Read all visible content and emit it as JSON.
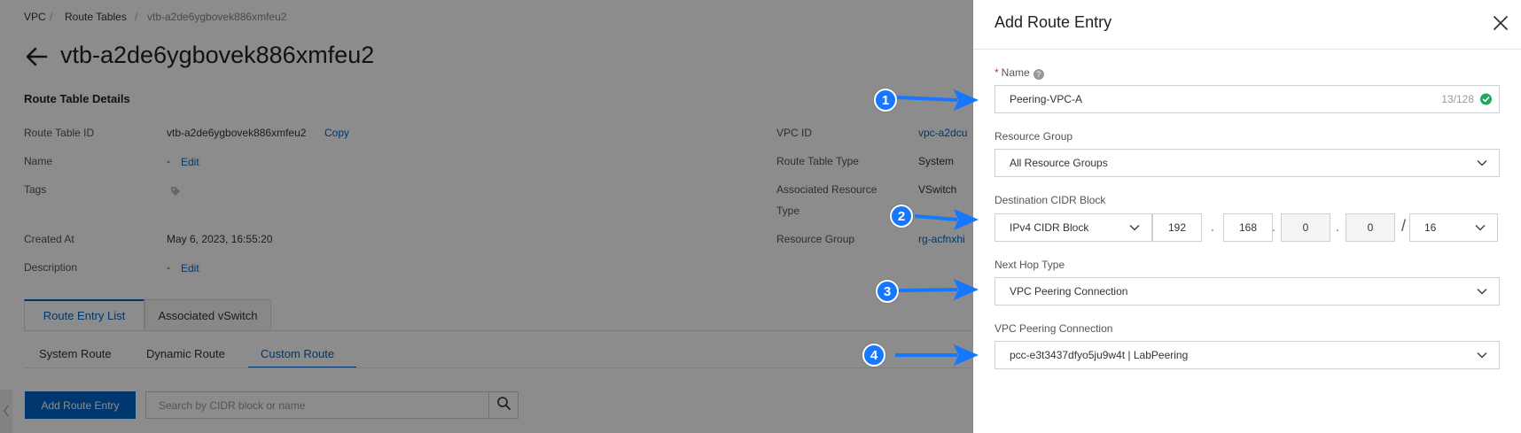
{
  "breadcrumb": [
    "VPC",
    "Route Tables",
    "vtb-a2de6ygbovek886xmfeu2"
  ],
  "page_title": "vtb-a2de6ygbovek886xmfeu2",
  "details": {
    "section_title": "Route Table Details",
    "route_table_id_label": "Route Table ID",
    "route_table_id_value": "vtb-a2de6ygbovek886xmfeu2",
    "copy_label": "Copy",
    "name_label": "Name",
    "name_value": "-",
    "edit_label": "Edit",
    "tags_label": "Tags",
    "created_at_label": "Created At",
    "created_at_value": "May 6, 2023, 16:55:20",
    "description_label": "Description",
    "description_value": "-",
    "vpc_id_label": "VPC ID",
    "vpc_id_value": "vpc-a2dcu",
    "route_table_type_label": "Route Table Type",
    "route_table_type_value": "System",
    "assoc_resource_label_1": "Associated Resource",
    "assoc_resource_label_2": "Type",
    "assoc_resource_value": "VSwitch",
    "resource_group_label": "Resource Group",
    "resource_group_value": "rg-acfnxhi"
  },
  "tabs": [
    "Route Entry List",
    "Associated vSwitch"
  ],
  "subtabs": [
    "System Route",
    "Dynamic Route",
    "Custom Route"
  ],
  "add_route_entry_button": "Add Route Entry",
  "search_placeholder": "Search by CIDR block or name",
  "drawer": {
    "title": "Add Route Entry",
    "name_label": "Name",
    "required_mark": "*",
    "help_mark": "?",
    "name_value": "Peering-VPC-A",
    "name_count": "13/128",
    "resource_group_label": "Resource Group",
    "resource_group_value": "All Resource Groups",
    "destination_label": "Destination CIDR Block",
    "cidr_type_value": "IPv4 CIDR Block",
    "octets": [
      "192",
      "168",
      "0",
      "0"
    ],
    "octet_sep": ".",
    "prefix_sep": "/",
    "prefix_value": "16",
    "next_hop_label": "Next Hop Type",
    "next_hop_value": "VPC Peering Connection",
    "peering_label": "VPC Peering Connection",
    "peering_value": "pcc-e3t3437dfyo5ju9w4t | LabPeering"
  },
  "callouts": [
    "1",
    "2",
    "3",
    "4"
  ],
  "colors": {
    "accent": "#0064c8",
    "callout": "#1677ff",
    "success": "#23a55a"
  }
}
